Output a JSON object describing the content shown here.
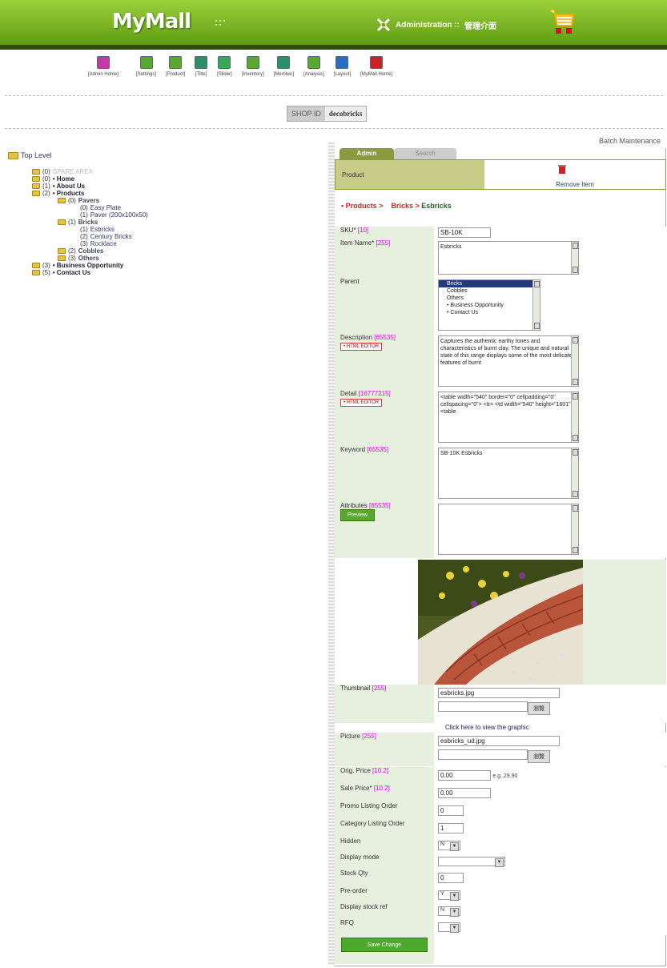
{
  "header": {
    "logo": "MyMall",
    "admin_label": "Administration ::",
    "admin_cn": "管理介面"
  },
  "nav": [
    {
      "label": "[Admin Home]",
      "color": "#c23aa8"
    },
    {
      "label": "[Settings]",
      "color": "#5aa830"
    },
    {
      "label": "[Product]",
      "color": "#5aa830"
    },
    {
      "label": "[Title]",
      "color": "#2a8f6a"
    },
    {
      "label": "[Slider]",
      "color": "#3aa85a"
    },
    {
      "label": "[Inventory]",
      "color": "#5aa830"
    },
    {
      "label": "[Member]",
      "color": "#2a8f6a"
    },
    {
      "label": "[Analysis]",
      "color": "#5aa830"
    },
    {
      "label": "[Layout]",
      "color": "#2a6fbf"
    },
    {
      "label": "[MyMall Home]",
      "color": "#c22"
    }
  ],
  "shop": {
    "label": "SHOP ID",
    "value": "decobricks"
  },
  "batch": "Batch Maintenance",
  "tree": {
    "root": "Top Level",
    "items": [
      {
        "indent": 1,
        "cnt": "(0)",
        "name": "SPARE AREA",
        "style": "grey",
        "folder": true
      },
      {
        "indent": 1,
        "cnt": "(0)",
        "name": "• Home",
        "style": "b",
        "folder": true
      },
      {
        "indent": 1,
        "cnt": "(1)",
        "name": "• About Us",
        "style": "b",
        "folder": true
      },
      {
        "indent": 1,
        "cnt": "(2)",
        "name": "• Products",
        "style": "b",
        "folder": true
      },
      {
        "indent": 2,
        "cnt": "(0)",
        "name": "Pavers",
        "style": "sub",
        "folder": true
      },
      {
        "indent": 3,
        "cnt": "(0)",
        "name": "Easy Plate",
        "style": "lk",
        "folder": false
      },
      {
        "indent": 3,
        "cnt": "(1)",
        "name": "Paver (200x100x50)",
        "style": "lk",
        "folder": false
      },
      {
        "indent": 2,
        "cnt": "(1)",
        "name": "Bricks",
        "style": "sub",
        "folder": true
      },
      {
        "indent": 3,
        "cnt": "(1)",
        "name": "Esbricks",
        "style": "lk",
        "folder": false
      },
      {
        "indent": 3,
        "cnt": "(2)",
        "name": "Century Bricks",
        "style": "lk",
        "folder": false
      },
      {
        "indent": 3,
        "cnt": "(3)",
        "name": "Rocklace",
        "style": "lk",
        "folder": false
      },
      {
        "indent": 2,
        "cnt": "(2)",
        "name": "Cobbles",
        "style": "sub",
        "folder": true
      },
      {
        "indent": 2,
        "cnt": "(3)",
        "name": "Others",
        "style": "sub",
        "folder": true
      },
      {
        "indent": 1,
        "cnt": "(3)",
        "name": "• Business Opportunity",
        "style": "b",
        "folder": true
      },
      {
        "indent": 1,
        "cnt": "(5)",
        "name": "• Contact Us",
        "style": "b",
        "folder": true
      }
    ]
  },
  "tabs": {
    "admin": "Admin",
    "search": "Search"
  },
  "product_label": "Product",
  "remove_item": "Remove Item",
  "crumb": {
    "a": "• Products >",
    "b": "Bricks >",
    "c": "Esbricks"
  },
  "form": {
    "sku": {
      "label": "SKU*",
      "cnt": "[10]",
      "value": "SB-10K"
    },
    "item_name": {
      "label": "Item Name*",
      "cnt": "[255]",
      "value": "Esbricks"
    },
    "parent": {
      "label": "Parent",
      "options": [
        "Bricks",
        "Cobbles",
        "Others",
        "• Business Opportunity",
        "• Contact Us"
      ]
    },
    "description": {
      "label": "Description",
      "cnt": "[65535]",
      "btn": "• HTML EDITOR",
      "value": "Captures the authentic earthy tones and characteristics of burnt clay. The unique and natural state of this range displays some of the most delicate features of burnt"
    },
    "detail": {
      "label": "Detail",
      "cnt": "[16777215]",
      "btn": "• HTML EDITOR",
      "value": "<table width=\"540\" border=\"0\" cellpadding=\"0\" cellspacing=\"0\"> <tr> <td width=\"540\" height=\"1601\"><table"
    },
    "keyword": {
      "label": "Keyword",
      "cnt": "[65535]",
      "value": "SB-10K Esbricks"
    },
    "attributes": {
      "label": "Attributes",
      "cnt": "[65535]",
      "btn": "Preview"
    },
    "thumbnail": {
      "label": "Thumbnail",
      "cnt": "[255]",
      "value": "esbricks.jpg",
      "browse": "瀏覽"
    },
    "view_graphic": "Click here to view the graphic",
    "picture": {
      "label": "Picture",
      "cnt": "[255]",
      "value": "esbricks_ud.jpg",
      "browse": "瀏覽"
    },
    "orig_price": {
      "label": "Orig. Price",
      "cnt": "[10.2]",
      "value": "0.00",
      "hint": "e.g. 29.90"
    },
    "sale_price": {
      "label": "Sale Price*",
      "cnt": "[10.2]",
      "value": "0.00"
    },
    "promo_order": {
      "label": "Promo Listing Order",
      "value": "0"
    },
    "cat_order": {
      "label": "Category Listing Order",
      "value": "1"
    },
    "hidden": {
      "label": "Hidden",
      "value": "N"
    },
    "display_mode": {
      "label": "Display mode",
      "value": ""
    },
    "stock_qty": {
      "label": "Stock Qty",
      "value": "0"
    },
    "pre_order": {
      "label": "Pre-order",
      "value": "Y"
    },
    "display_stock": {
      "label": "Display stock ref",
      "value": "N"
    },
    "rfq": {
      "label": "RFQ",
      "value": ""
    }
  },
  "save_btn": "Save Change"
}
